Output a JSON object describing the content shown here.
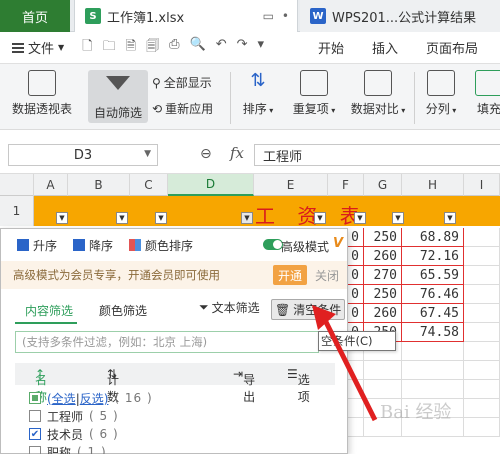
{
  "tabs": {
    "home": "首页",
    "active_doc": "工作簿1.xlsx",
    "inactive_doc": "WPS201...公式计算结果"
  },
  "menu": {
    "file": "文件",
    "start": "开始",
    "insert": "插入",
    "layout": "页面布局"
  },
  "ribbon": {
    "pivot": "数据透视表",
    "autofilter": "自动筛选",
    "show_all": "全部显示",
    "reapply": "重新应用",
    "sort": "排序",
    "duplicates": "重复项",
    "compare": "数据对比",
    "split": "分列",
    "fill": "填充"
  },
  "formula_bar": {
    "cell_ref": "D3",
    "fx": "fx",
    "content": "工程师"
  },
  "sheet": {
    "columns": [
      "A",
      "B",
      "C",
      "D",
      "E",
      "F",
      "G",
      "H",
      "I"
    ],
    "row1": "1",
    "title": "工 资 表",
    "rows": [
      {
        "f": "0",
        "g": "250",
        "h": "68.89"
      },
      {
        "f": "0",
        "g": "260",
        "h": "72.16"
      },
      {
        "f": "0",
        "g": "270",
        "h": "65.59"
      },
      {
        "f": "0",
        "g": "250",
        "h": "76.46"
      },
      {
        "f": "0",
        "g": "260",
        "h": "67.45"
      },
      {
        "f": "0",
        "g": "250",
        "h": "74.58"
      }
    ]
  },
  "filter_panel": {
    "asc": "升序",
    "desc": "降序",
    "color_sort": "颜色排序",
    "advanced_mode": "高级模式",
    "vip_mark": "V",
    "notice": "高级模式为会员专享，开通会员即可使用",
    "open": "开通",
    "close": "关闭",
    "tab_content": "内容筛选",
    "tab_color": "颜色筛选",
    "text_filter": "文本筛选",
    "clear": "清空条件",
    "search_placeholder": "(支持多条件过滤，例如：北京 上海)",
    "col_name": "名称",
    "col_count": "计数",
    "export": "导出",
    "options": "选项",
    "items": [
      {
        "label_a": "(全选",
        "label_b": "反选)",
        "count": "( 16 )",
        "state": "partial"
      },
      {
        "label": "工程师",
        "count": "( 5 )",
        "state": "unchecked"
      },
      {
        "label": "技术员",
        "count": "( 6 )",
        "state": "checked"
      },
      {
        "label": "职称",
        "count": "( 1 )",
        "state": "unchecked"
      }
    ]
  },
  "tooltip": "空条件(C)",
  "colors": {
    "wps_green": "#2e9e5b",
    "title_fill": "#f7a600",
    "title_text": "#d91c1c",
    "arrow": "#e02020"
  }
}
